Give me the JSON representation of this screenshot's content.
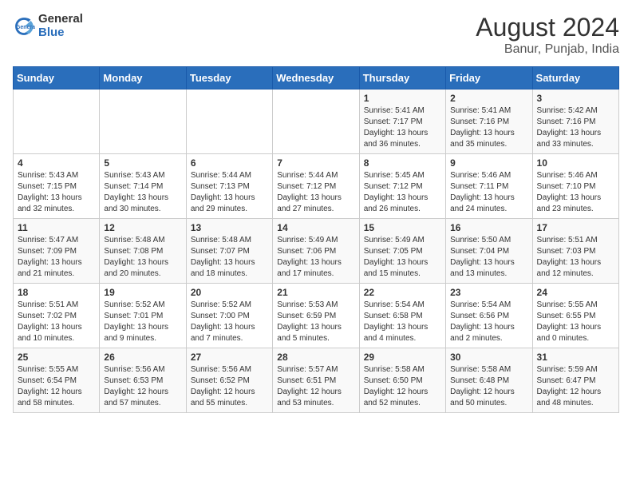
{
  "header": {
    "logo_general": "General",
    "logo_blue": "Blue",
    "month_year": "August 2024",
    "location": "Banur, Punjab, India"
  },
  "days_of_week": [
    "Sunday",
    "Monday",
    "Tuesday",
    "Wednesday",
    "Thursday",
    "Friday",
    "Saturday"
  ],
  "weeks": [
    [
      {
        "day": "",
        "content": ""
      },
      {
        "day": "",
        "content": ""
      },
      {
        "day": "",
        "content": ""
      },
      {
        "day": "",
        "content": ""
      },
      {
        "day": "1",
        "content": "Sunrise: 5:41 AM\nSunset: 7:17 PM\nDaylight: 13 hours\nand 36 minutes."
      },
      {
        "day": "2",
        "content": "Sunrise: 5:41 AM\nSunset: 7:16 PM\nDaylight: 13 hours\nand 35 minutes."
      },
      {
        "day": "3",
        "content": "Sunrise: 5:42 AM\nSunset: 7:16 PM\nDaylight: 13 hours\nand 33 minutes."
      }
    ],
    [
      {
        "day": "4",
        "content": "Sunrise: 5:43 AM\nSunset: 7:15 PM\nDaylight: 13 hours\nand 32 minutes."
      },
      {
        "day": "5",
        "content": "Sunrise: 5:43 AM\nSunset: 7:14 PM\nDaylight: 13 hours\nand 30 minutes."
      },
      {
        "day": "6",
        "content": "Sunrise: 5:44 AM\nSunset: 7:13 PM\nDaylight: 13 hours\nand 29 minutes."
      },
      {
        "day": "7",
        "content": "Sunrise: 5:44 AM\nSunset: 7:12 PM\nDaylight: 13 hours\nand 27 minutes."
      },
      {
        "day": "8",
        "content": "Sunrise: 5:45 AM\nSunset: 7:12 PM\nDaylight: 13 hours\nand 26 minutes."
      },
      {
        "day": "9",
        "content": "Sunrise: 5:46 AM\nSunset: 7:11 PM\nDaylight: 13 hours\nand 24 minutes."
      },
      {
        "day": "10",
        "content": "Sunrise: 5:46 AM\nSunset: 7:10 PM\nDaylight: 13 hours\nand 23 minutes."
      }
    ],
    [
      {
        "day": "11",
        "content": "Sunrise: 5:47 AM\nSunset: 7:09 PM\nDaylight: 13 hours\nand 21 minutes."
      },
      {
        "day": "12",
        "content": "Sunrise: 5:48 AM\nSunset: 7:08 PM\nDaylight: 13 hours\nand 20 minutes."
      },
      {
        "day": "13",
        "content": "Sunrise: 5:48 AM\nSunset: 7:07 PM\nDaylight: 13 hours\nand 18 minutes."
      },
      {
        "day": "14",
        "content": "Sunrise: 5:49 AM\nSunset: 7:06 PM\nDaylight: 13 hours\nand 17 minutes."
      },
      {
        "day": "15",
        "content": "Sunrise: 5:49 AM\nSunset: 7:05 PM\nDaylight: 13 hours\nand 15 minutes."
      },
      {
        "day": "16",
        "content": "Sunrise: 5:50 AM\nSunset: 7:04 PM\nDaylight: 13 hours\nand 13 minutes."
      },
      {
        "day": "17",
        "content": "Sunrise: 5:51 AM\nSunset: 7:03 PM\nDaylight: 13 hours\nand 12 minutes."
      }
    ],
    [
      {
        "day": "18",
        "content": "Sunrise: 5:51 AM\nSunset: 7:02 PM\nDaylight: 13 hours\nand 10 minutes."
      },
      {
        "day": "19",
        "content": "Sunrise: 5:52 AM\nSunset: 7:01 PM\nDaylight: 13 hours\nand 9 minutes."
      },
      {
        "day": "20",
        "content": "Sunrise: 5:52 AM\nSunset: 7:00 PM\nDaylight: 13 hours\nand 7 minutes."
      },
      {
        "day": "21",
        "content": "Sunrise: 5:53 AM\nSunset: 6:59 PM\nDaylight: 13 hours\nand 5 minutes."
      },
      {
        "day": "22",
        "content": "Sunrise: 5:54 AM\nSunset: 6:58 PM\nDaylight: 13 hours\nand 4 minutes."
      },
      {
        "day": "23",
        "content": "Sunrise: 5:54 AM\nSunset: 6:56 PM\nDaylight: 13 hours\nand 2 minutes."
      },
      {
        "day": "24",
        "content": "Sunrise: 5:55 AM\nSunset: 6:55 PM\nDaylight: 13 hours\nand 0 minutes."
      }
    ],
    [
      {
        "day": "25",
        "content": "Sunrise: 5:55 AM\nSunset: 6:54 PM\nDaylight: 12 hours\nand 58 minutes."
      },
      {
        "day": "26",
        "content": "Sunrise: 5:56 AM\nSunset: 6:53 PM\nDaylight: 12 hours\nand 57 minutes."
      },
      {
        "day": "27",
        "content": "Sunrise: 5:56 AM\nSunset: 6:52 PM\nDaylight: 12 hours\nand 55 minutes."
      },
      {
        "day": "28",
        "content": "Sunrise: 5:57 AM\nSunset: 6:51 PM\nDaylight: 12 hours\nand 53 minutes."
      },
      {
        "day": "29",
        "content": "Sunrise: 5:58 AM\nSunset: 6:50 PM\nDaylight: 12 hours\nand 52 minutes."
      },
      {
        "day": "30",
        "content": "Sunrise: 5:58 AM\nSunset: 6:48 PM\nDaylight: 12 hours\nand 50 minutes."
      },
      {
        "day": "31",
        "content": "Sunrise: 5:59 AM\nSunset: 6:47 PM\nDaylight: 12 hours\nand 48 minutes."
      }
    ]
  ]
}
